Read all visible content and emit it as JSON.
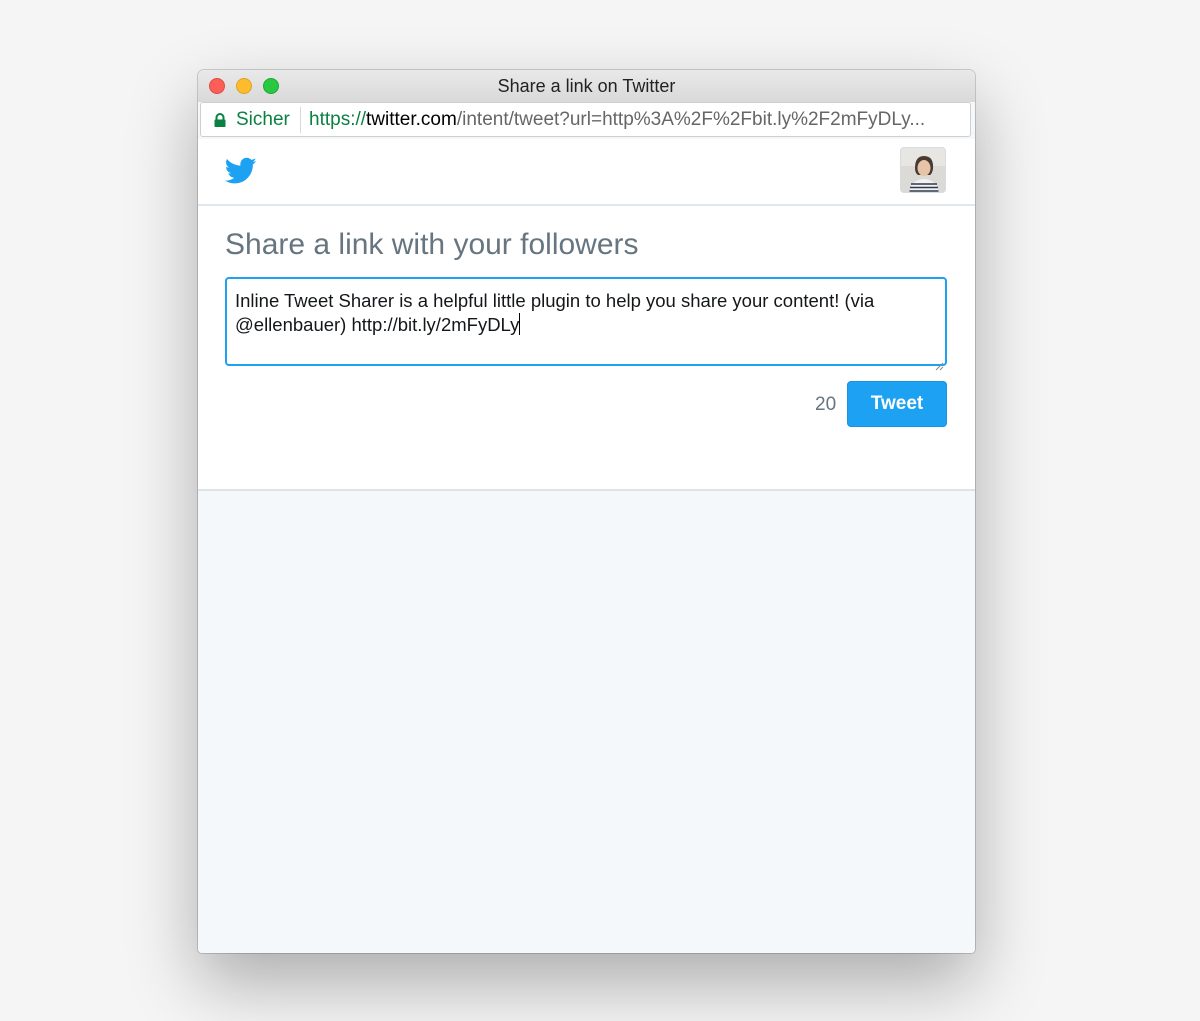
{
  "window": {
    "title": "Share a link on Twitter"
  },
  "addressbar": {
    "secure_label": "Sicher",
    "url_scheme": "https://",
    "url_host": "twitter.com",
    "url_path": "/intent/tweet?url=http%3A%2F%2Fbit.ly%2F2mFyDLy..."
  },
  "header": {
    "logo_icon": "twitter-bird-icon",
    "avatar_icon": "user-avatar"
  },
  "compose": {
    "heading": "Share a link with your followers",
    "tweet_text": "Inline Tweet Sharer is a helpful little plugin to help you share your content! (via @ellenbauer) http://bit.ly/2mFyDLy",
    "char_count": "20",
    "tweet_button_label": "Tweet"
  },
  "colors": {
    "twitter_blue": "#1da1f2",
    "secure_green": "#0b8043",
    "heading_gray": "#66757f"
  }
}
